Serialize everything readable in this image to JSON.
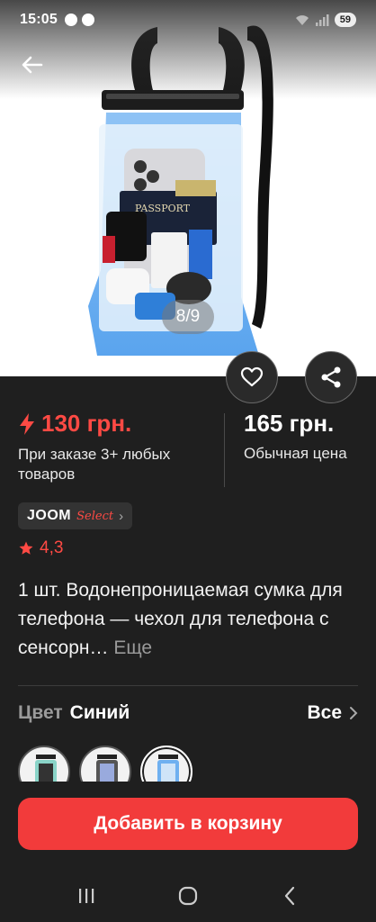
{
  "status_bar": {
    "time": "15:05",
    "battery": "59"
  },
  "gallery": {
    "counter": "8/9",
    "product_text": "PASSPORT"
  },
  "pricing": {
    "promo_price": "130 грн.",
    "promo_note": "При заказе 3+ любых товаров",
    "regular_price": "165 грн.",
    "regular_note": "Обычная цена",
    "accent_color": "#ff4a44"
  },
  "badge": {
    "brand": "JOOM",
    "tag": "Select"
  },
  "rating": {
    "value": "4,3"
  },
  "product": {
    "title": "1 шт. Водонепроницаемая сумка для телефона — чехол для телефона с сенсорн…",
    "more_label": "Еще"
  },
  "color": {
    "label": "Цвет",
    "value": "Синий",
    "all_label": "Все",
    "swatch_count": 3
  },
  "cta": {
    "label": "Добавить в корзину",
    "color": "#f23b3b"
  },
  "icons": {
    "back": "arrow-left-icon",
    "favorite": "heart-icon",
    "share": "share-icon",
    "rating": "star-icon",
    "promo": "lightning-icon"
  }
}
